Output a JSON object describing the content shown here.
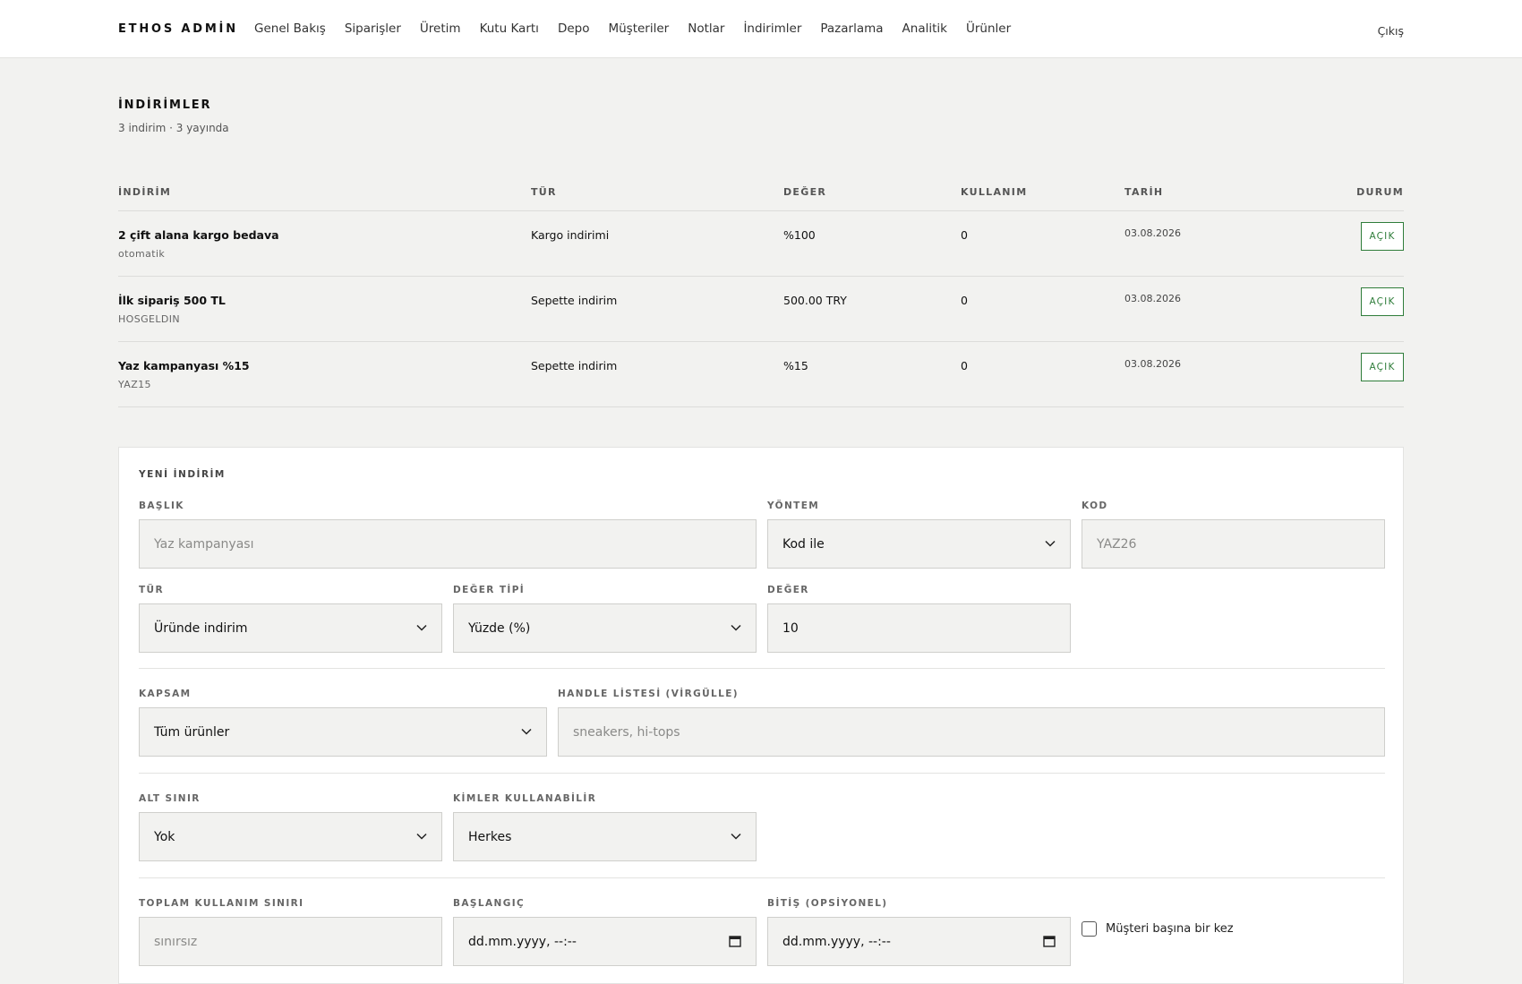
{
  "topbar": {
    "brand": "ETHOS ADMİN",
    "nav": [
      "Genel Bakış",
      "Siparişler",
      "Üretim",
      "Kutu Kartı",
      "Depo",
      "Müşteriler",
      "Notlar",
      "İndirimler",
      "Pazarlama",
      "Analitik",
      "Ürünler"
    ],
    "logout": "Çıkış"
  },
  "page": {
    "title": "İNDİRİMLER",
    "subtitle": "3 indirim · 3 yayında"
  },
  "table": {
    "headers": {
      "discount": "İNDİRİM",
      "type": "TÜR",
      "value": "DEĞER",
      "usage": "KULLANIM",
      "date": "TARİH",
      "status": "DURUM"
    },
    "rows": [
      {
        "name": "2 çift alana kargo bedava",
        "code": "otomatik",
        "type": "Kargo indirimi",
        "value": "%100",
        "usage": "0",
        "date": "03.08.2026",
        "status": "AÇIK"
      },
      {
        "name": "İlk sipariş 500 TL",
        "code": "HOSGELDIN",
        "type": "Sepette indirim",
        "value": "500.00 TRY",
        "usage": "0",
        "date": "03.08.2026",
        "status": "AÇIK"
      },
      {
        "name": "Yaz kampanyası %15",
        "code": "YAZ15",
        "type": "Sepette indirim",
        "value": "%15",
        "usage": "0",
        "date": "03.08.2026",
        "status": "AÇIK"
      }
    ]
  },
  "form": {
    "title": "YENİ İNDİRİM",
    "title_label": "BAŞLIK",
    "title_placeholder": "Yaz kampanyası",
    "method_label": "YÖNTEM",
    "method_value": "Kod ile",
    "code_label": "KOD",
    "code_placeholder": "YAZ26",
    "type_label": "TÜR",
    "type_value": "Üründe indirim",
    "value_type_label": "DEĞER TİPİ",
    "value_type_value": "Yüzde (%)",
    "value_label": "DEĞER",
    "value_value": "10",
    "scope_label": "KAPSAM",
    "scope_value": "Tüm ürünler",
    "handles_label": "HANDLE LİSTESİ (VİRGÜLLE)",
    "handles_placeholder": "sneakers, hi-tops",
    "min_label": "ALT SINIR",
    "min_value": "Yok",
    "who_label": "KİMLER KULLANABİLİR",
    "who_value": "Herkes",
    "limit_label": "TOPLAM KULLANIM SINIRI",
    "limit_placeholder": "sınırsız",
    "start_label": "BAŞLANGIÇ",
    "start_placeholder": "dd.mm.yyyy, --:--",
    "end_label": "BİTİŞ (OPSİYONEL)",
    "end_placeholder": "dd.mm.yyyy, --:--",
    "once_per_customer": "Müşteri başına bir kez"
  },
  "colors": {
    "accent_green": "#2f7d3a",
    "background": "#f2f2f0",
    "panel": "#ffffff"
  },
  "icons": [
    "chevron-down-icon",
    "calendar-icon",
    "checkbox-icon"
  ]
}
